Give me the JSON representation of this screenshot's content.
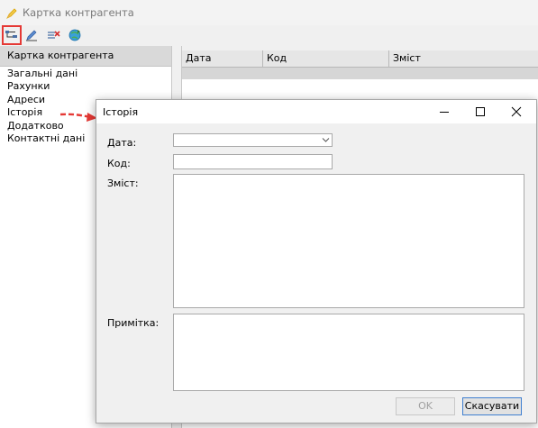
{
  "window": {
    "title": "Картка контрагента"
  },
  "toolbar": {
    "buttons": [
      {
        "icon": "history-tree-icon",
        "selected": true
      },
      {
        "icon": "edit-pencil-icon",
        "selected": false
      },
      {
        "icon": "delete-record-icon",
        "selected": false
      },
      {
        "icon": "refresh-globe-icon",
        "selected": false
      }
    ]
  },
  "left_panel": {
    "header": "Картка контрагента",
    "items": [
      "Загальні дані",
      "Рахунки",
      "Адреси",
      "Історія",
      "Додатково",
      "Контактні дані"
    ]
  },
  "grid": {
    "columns": [
      "Дата",
      "Код",
      "Зміст"
    ]
  },
  "dialog": {
    "title": "Історія",
    "labels": {
      "date": "Дата:",
      "code": "Код:",
      "content": "Зміст:",
      "note": "Примітка:"
    },
    "values": {
      "date": "",
      "code": "",
      "content": "",
      "note": ""
    },
    "buttons": {
      "ok": "OK",
      "cancel": "Скасувати"
    }
  },
  "colors": {
    "annotation_red": "#e53935",
    "accent_blue": "#3f7fd0"
  }
}
